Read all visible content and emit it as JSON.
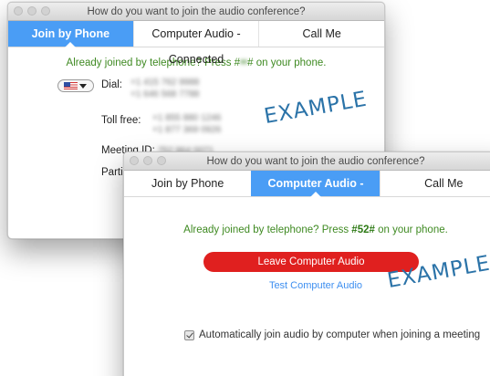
{
  "back_window": {
    "title": "How do you want to join the audio conference?",
    "tabs": [
      {
        "label": "Join by Phone",
        "active": true
      },
      {
        "label": "Computer Audio - Connected",
        "active": false
      },
      {
        "label": "Call Me",
        "active": false
      }
    ],
    "note_before": "Already joined by telephone? Press #",
    "note_code": "••",
    "note_after": "# on your phone.",
    "country_flag_icon": "us-flag-icon",
    "dial_label": "Dial:",
    "dial_numbers": [
      "+1 415 762 9988",
      "+1 646 568 7788"
    ],
    "toll_free_label": "Toll free:",
    "toll_free_numbers": [
      "+1 855 880 1246",
      "+1 877 369 0926"
    ],
    "meeting_id_label": "Meeting ID:",
    "meeting_id_value": "752 864 0071",
    "participant_label": "Parti",
    "watermark": "EXAMPLE"
  },
  "front_window": {
    "title": "How do you want to join the audio conference?",
    "tabs": [
      {
        "label": "Join by Phone",
        "active": false
      },
      {
        "label": "Computer Audio - Connected",
        "active": true
      },
      {
        "label": "Call Me",
        "active": false
      }
    ],
    "note_before": "Already joined by telephone? Press ",
    "note_code": "#52#",
    "note_after": " on your phone.",
    "leave_button": "Leave Computer Audio",
    "test_link": "Test Computer Audio",
    "auto_join_checked": true,
    "auto_join_label": "Automatically join audio by computer when joining a meeting",
    "watermark": "EXAMPLE"
  },
  "colors": {
    "accent_blue": "#4a9df5",
    "leave_red": "#e0201f",
    "note_green": "#3f8a22",
    "link_blue": "#3e8ff0",
    "watermark_blue": "#2b73a8"
  }
}
